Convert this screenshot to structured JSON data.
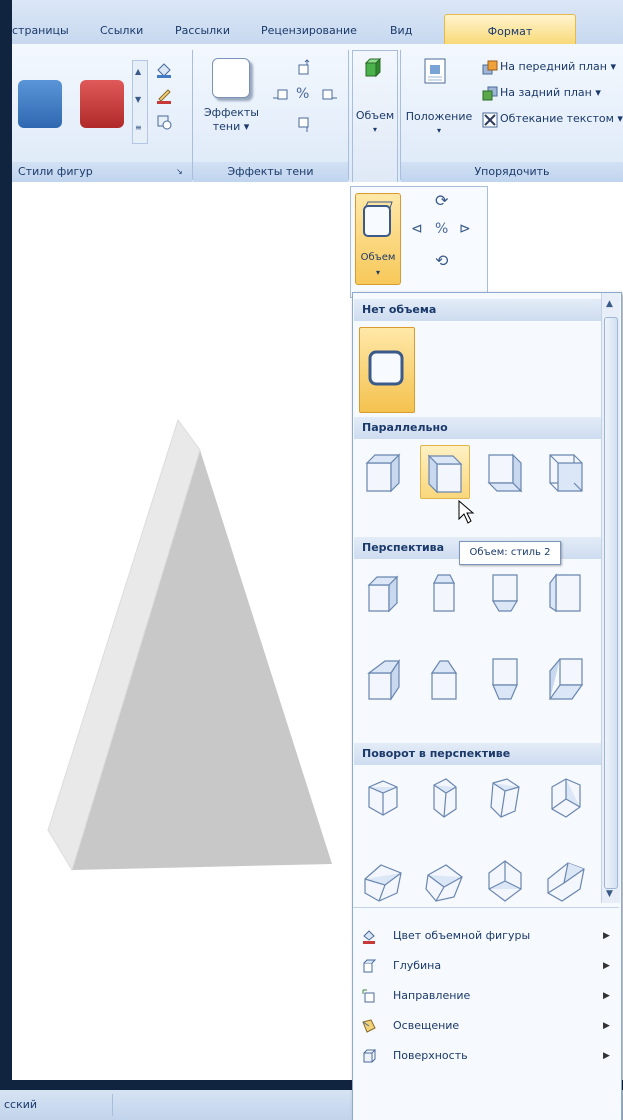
{
  "tabs": [
    "страницы",
    "Ссылки",
    "Рассылки",
    "Рецензирование",
    "Вид",
    "Формат"
  ],
  "ribbon": {
    "group_styles": "Стили фигур",
    "shadow_btn_line1": "Эффекты",
    "shadow_btn_line2": "тени",
    "group_shadow": "Эффекты тени",
    "volume_btn": "Объем",
    "position_btn": "Положение",
    "bring_front": "На передний план",
    "send_back": "На задний план",
    "wrap_text": "Обтекание текстом",
    "group_arrange": "Упорядочить"
  },
  "popup": {
    "volume_label": "Объем"
  },
  "gallery": {
    "no_volume": "Нет объема",
    "parallel": "Параллельно",
    "perspective": "Перспектива",
    "perspective_rotation": "Поворот в перспективе",
    "tooltip": "Объем: стиль 2"
  },
  "menu": {
    "color": "Цвет объемной фигуры",
    "depth": "Глубина",
    "direction": "Направление",
    "lighting": "Освещение",
    "surface": "Поверхность"
  },
  "status": {
    "language": "сский"
  },
  "colors": {
    "swatch_blue": "#3f7cc4",
    "swatch_red": "#c83a3a",
    "highlight": "#f7c85a"
  }
}
